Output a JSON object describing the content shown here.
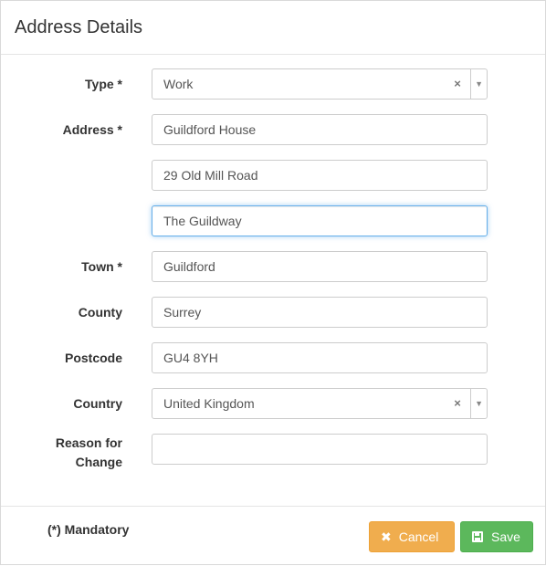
{
  "dialog": {
    "title": "Address Details"
  },
  "form": {
    "type": {
      "label": "Type *",
      "value": "Work",
      "clear_glyph": "×",
      "arrow_glyph": "▼"
    },
    "address": {
      "label": "Address *",
      "line1": "Guildford House",
      "line2": "29 Old Mill Road",
      "line3": "The Guildway"
    },
    "town": {
      "label": "Town *",
      "value": "Guildford"
    },
    "county": {
      "label": "County",
      "value": "Surrey"
    },
    "postcode": {
      "label": "Postcode",
      "value": "GU4 8YH"
    },
    "country": {
      "label": "Country",
      "value": "United Kingdom",
      "clear_glyph": "×",
      "arrow_glyph": "▼"
    },
    "reason": {
      "label_line1": "Reason for",
      "label_line2": "Change",
      "value": ""
    }
  },
  "footer": {
    "mandatory_note": "(*) Mandatory",
    "cancel_label": "Cancel",
    "cancel_icon": "✖",
    "save_label": "Save"
  },
  "colors": {
    "cancel": "#f0ad4e",
    "save": "#5cb85c",
    "focus_border": "#66afe9"
  }
}
